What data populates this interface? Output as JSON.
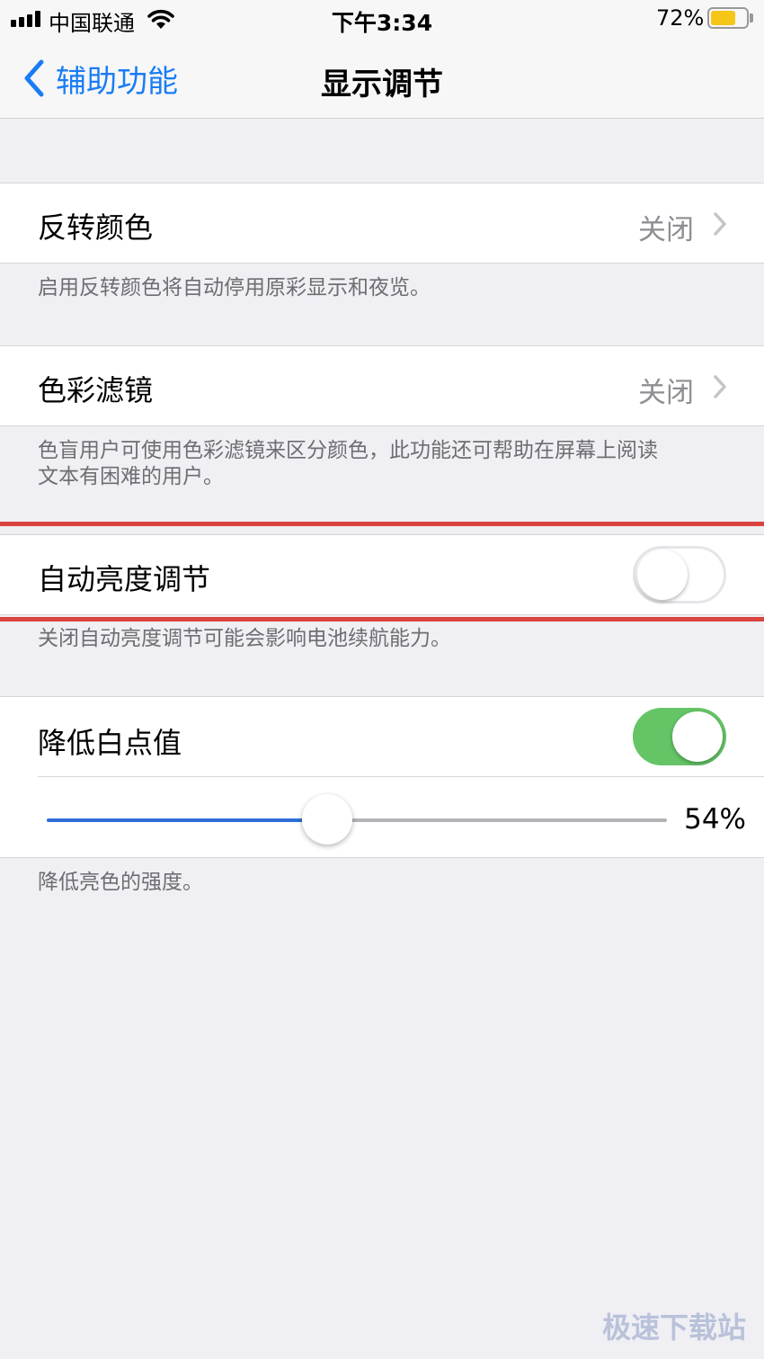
{
  "status_bar": {
    "carrier": "中国联通",
    "time": "下午3:34",
    "battery_percent": "72%",
    "battery_level": 0.72,
    "battery_color": "#f5c518"
  },
  "nav": {
    "back_label": "辅助功能",
    "back_icon": "chevron-left-icon",
    "title": "显示调节",
    "accent_color": "#1a7cf5"
  },
  "sections": {
    "invert_colors": {
      "label": "反转颜色",
      "value": "关闭",
      "footer": "启用反转颜色将自动停用原彩显示和夜览。"
    },
    "color_filters": {
      "label": "色彩滤镜",
      "value": "关闭",
      "footer_line1": "色盲用户可使用色彩滤镜来区分颜色，此功能还可帮助在屏幕上阅读",
      "footer_line2": "文本有困难的用户。"
    },
    "auto_brightness": {
      "label": "自动亮度调节",
      "enabled": false,
      "footer": "关闭自动亮度调节可能会影响电池续航能力。",
      "highlight_color": "#d9443e"
    },
    "reduce_white_point": {
      "label": "降低白点值",
      "enabled": true,
      "toggle_on_color": "#65c466",
      "slider_value": 0.54,
      "slider_value_text": "54%",
      "slider_fill_color": "#2f6fd6",
      "footer": "降低亮色的强度。"
    }
  },
  "watermark": "极速下载站"
}
